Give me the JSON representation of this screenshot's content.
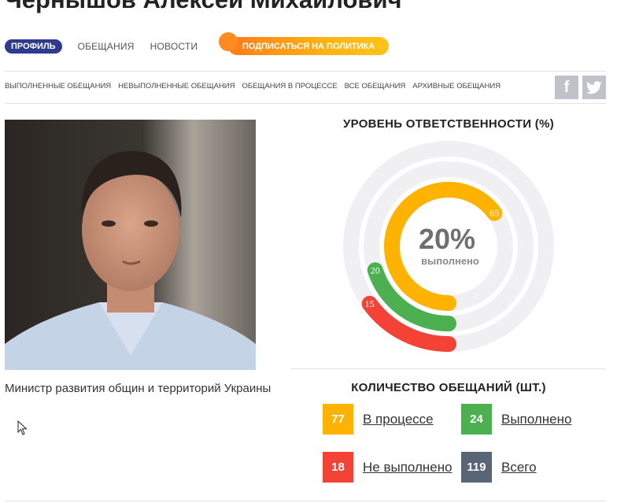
{
  "header": {
    "title": "Чернышов Алексей Михайлович"
  },
  "tabs": [
    {
      "label": "ПРОФИЛЬ"
    },
    {
      "label": "ОБЕЩАНИЯ"
    },
    {
      "label": "НОВОСТИ"
    }
  ],
  "subscribe": {
    "label": "ПОДПИСАТЬСЯ НА ПОЛИТИКА",
    "color": "#ffb313"
  },
  "subnav": [
    {
      "label": "ВЫПОЛНЕННЫЕ ОБЕЩАНИЯ"
    },
    {
      "label": "НЕВЫПОЛНЕННЫЕ ОБЕЩАНИЯ"
    },
    {
      "label": "ОБЕЩАНИЯ В ПРОЦЕССЕ"
    },
    {
      "label": "ВСЕ ОБЕЩАНИЯ"
    },
    {
      "label": "АРХИВНЫЕ ОБЕЩАНИЯ"
    }
  ],
  "social": {
    "facebook_icon": "f",
    "twitter_icon": "twitter-bird"
  },
  "profile": {
    "caption": "Министр развития общин и территорий Украины"
  },
  "responsibility": {
    "heading": "УРОВЕНЬ ОТВЕТСТВЕННОСТИ (%)",
    "percent": "20%",
    "percent_label": "выполнено",
    "arcs": [
      {
        "value": 65,
        "label": "65",
        "color": "#ffb300"
      },
      {
        "value": 20,
        "label": "20",
        "color": "#4caf50"
      },
      {
        "value": 15,
        "label": "15",
        "color": "#f44336"
      }
    ]
  },
  "promises": {
    "heading": "КОЛИЧЕСТВО ОБЕЩАНИЙ (ШТ.)",
    "items": [
      {
        "count": "77",
        "label": "В процессе",
        "color": "#ffb300"
      },
      {
        "count": "24",
        "label": "Выполнено",
        "color": "#4caf50"
      },
      {
        "count": "18",
        "label": "Не выполнено",
        "color": "#f44336"
      },
      {
        "count": "119",
        "label": "Всего",
        "color": "#5a6477"
      }
    ]
  }
}
